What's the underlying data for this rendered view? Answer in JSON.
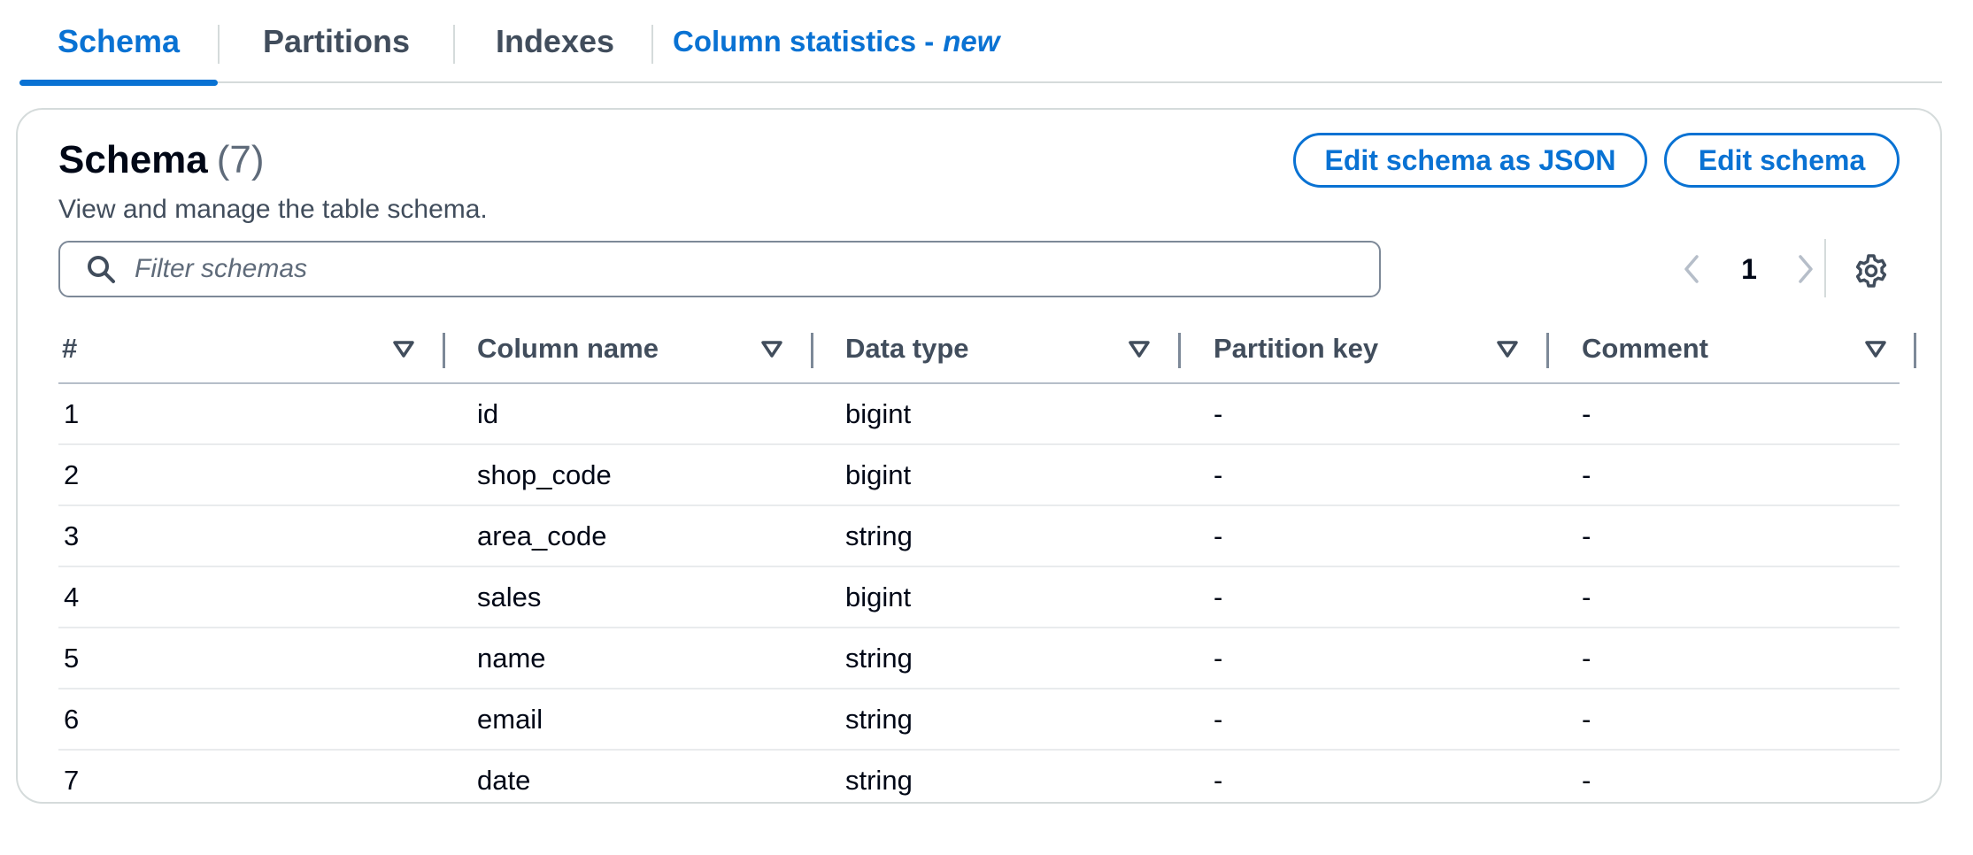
{
  "tabs": [
    {
      "label": "Schema",
      "active": true
    },
    {
      "label": "Partitions",
      "active": false
    },
    {
      "label": "Indexes",
      "active": false
    },
    {
      "label": "Column statistics -",
      "new_label": "new",
      "active": false
    }
  ],
  "header": {
    "title": "Schema",
    "count": "(7)",
    "description": "View and manage the table schema."
  },
  "actions": {
    "edit_json_label": "Edit schema as JSON",
    "edit_label": "Edit schema"
  },
  "filter": {
    "placeholder": "Filter schemas",
    "value": ""
  },
  "pagination": {
    "current_page": "1"
  },
  "icons": {
    "search": "search-icon",
    "prev": "chevron-left-icon",
    "next": "chevron-right-icon",
    "settings": "gear-icon",
    "sort": "caret-down-icon"
  },
  "colors": {
    "accent": "#0972d3",
    "text": "#000716",
    "muted": "#5f6b7a",
    "border": "#d5dbdb"
  },
  "table": {
    "columns": [
      "#",
      "Column name",
      "Data type",
      "Partition key",
      "Comment"
    ],
    "rows": [
      [
        "1",
        "id",
        "bigint",
        "-",
        "-"
      ],
      [
        "2",
        "shop_code",
        "bigint",
        "-",
        "-"
      ],
      [
        "3",
        "area_code",
        "string",
        "-",
        "-"
      ],
      [
        "4",
        "sales",
        "bigint",
        "-",
        "-"
      ],
      [
        "5",
        "name",
        "string",
        "-",
        "-"
      ],
      [
        "6",
        "email",
        "string",
        "-",
        "-"
      ],
      [
        "7",
        "date",
        "string",
        "-",
        "-"
      ]
    ]
  }
}
